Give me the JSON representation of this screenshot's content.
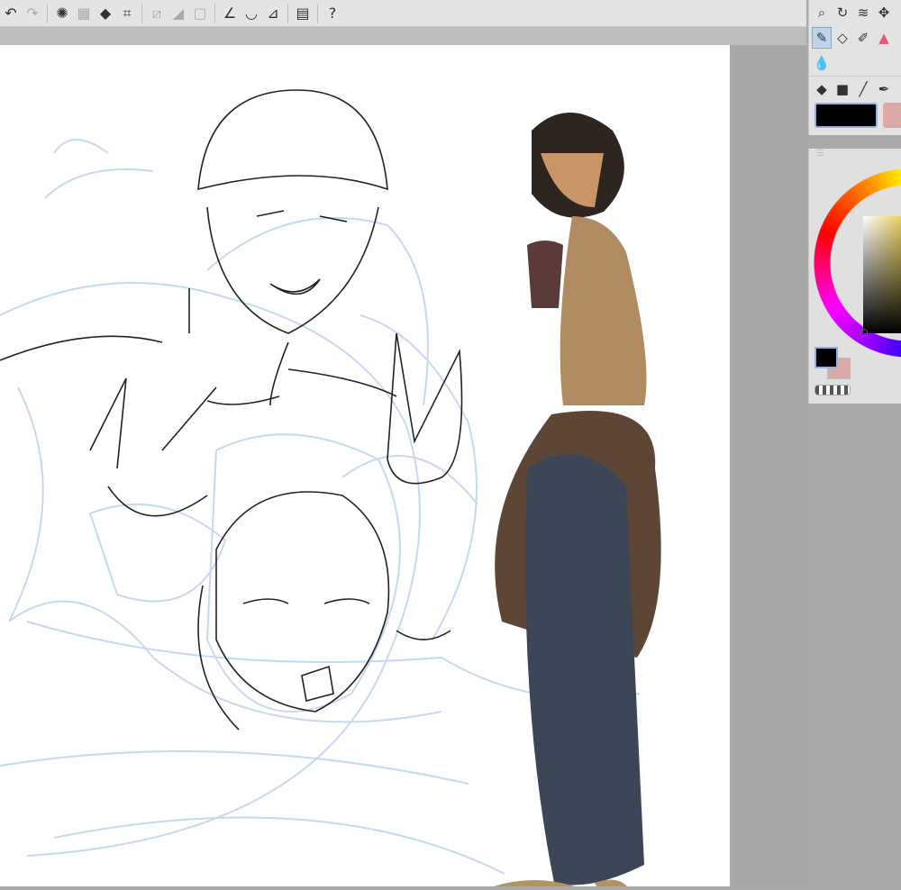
{
  "toolbar": {
    "icons": [
      "undo-icon",
      "redo-icon",
      "select-all-icon",
      "deselect-icon",
      "fill-icon",
      "transform-icon",
      "clear-icon",
      "fill-selection-icon",
      "frame-icon",
      "ruler-perspective-icon",
      "ruler-ellipse-icon",
      "ruler-parallel-icon",
      "device-icon",
      "help-icon"
    ]
  },
  "tools": {
    "rows": [
      [
        "zoom-icon",
        "rotate-icon",
        "layer-select-icon",
        "move-icon"
      ],
      [
        "pen-icon",
        "eraser-icon",
        "marker-icon",
        "decoration-icon"
      ],
      [
        "blend-icon"
      ],
      [
        "fill-icon",
        "gradient-icon",
        "line-icon",
        "vector-pen-icon"
      ]
    ],
    "selected": "pen-icon"
  },
  "colors": {
    "main": "#000000",
    "sub": "#dba9a6",
    "canvas_bg": "#ffffff",
    "sketch": "#c6d8f2",
    "lineart": "#222222"
  }
}
